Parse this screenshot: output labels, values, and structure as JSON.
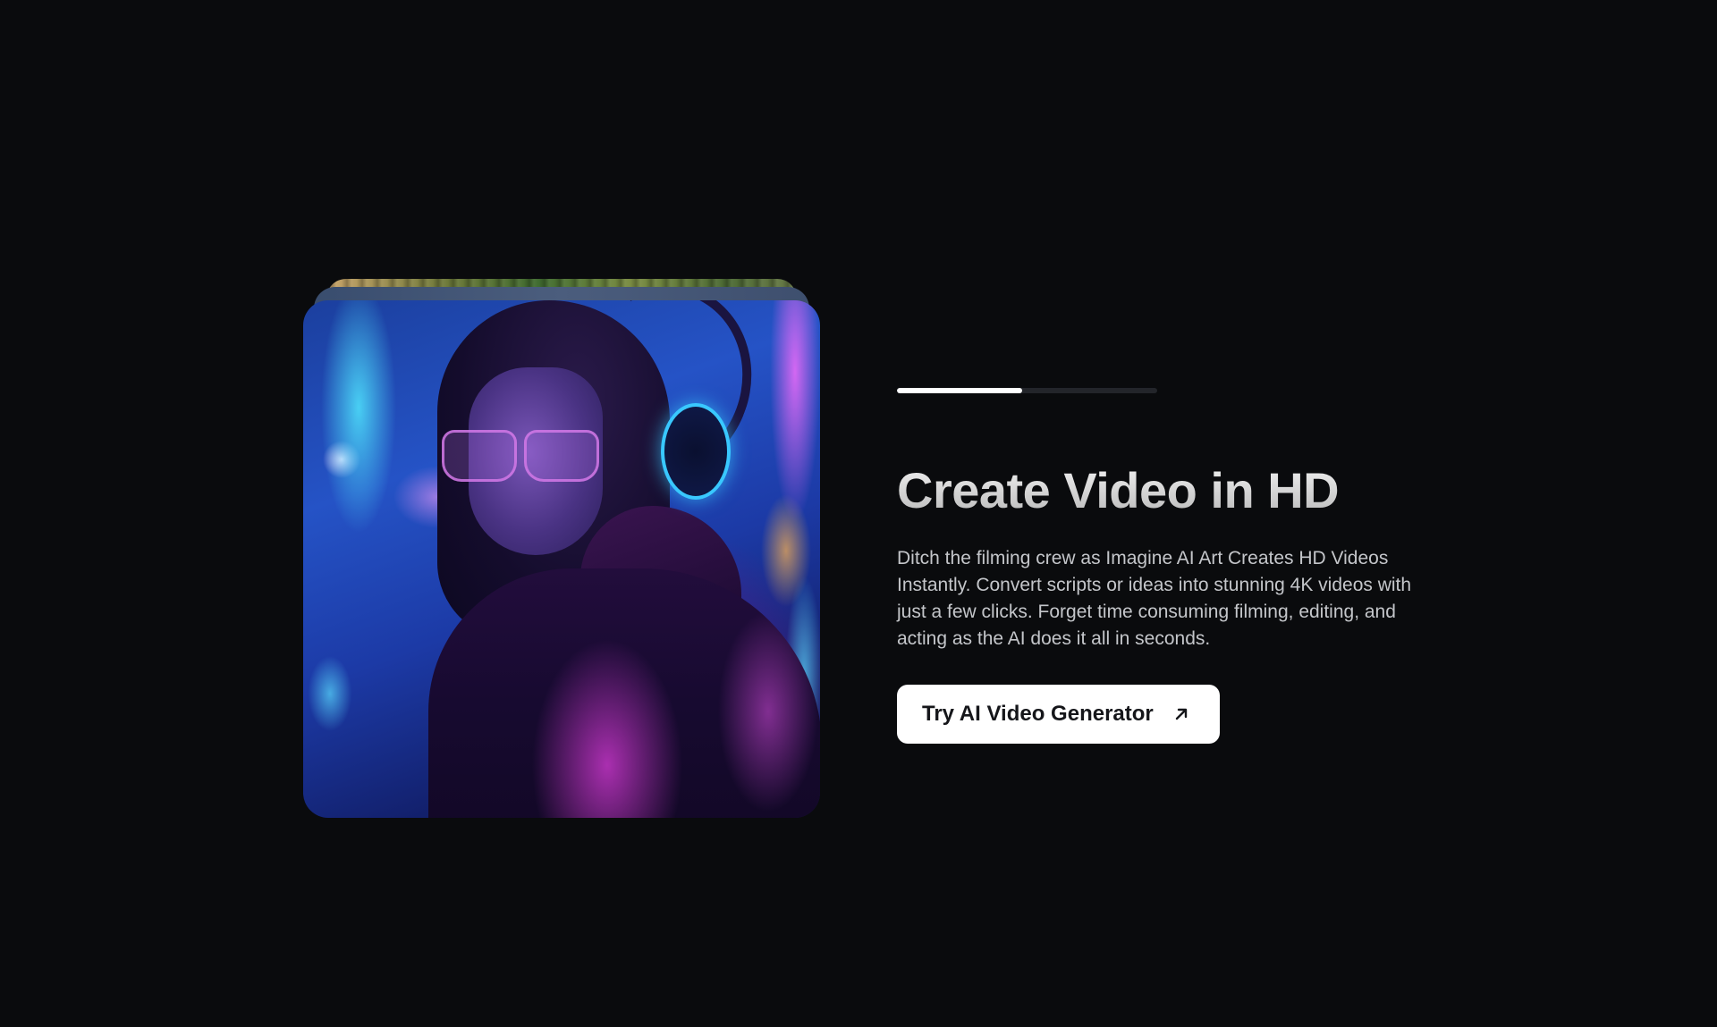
{
  "hero": {
    "progress_fraction": 0.48,
    "title": "Create Video in HD",
    "description": "Ditch the filming crew as Imagine AI Art Creates HD Videos Instantly. Convert scripts or ideas into stunning 4K videos with just a few clicks. Forget time consuming filming, editing, and acting as the AI does it all in seconds.",
    "cta_label": "Try AI Video Generator",
    "cta_icon": "arrow-up-right-icon"
  },
  "colors": {
    "background": "#0a0b0d",
    "accent_button": "#ffffff",
    "progress_track": "#23252a",
    "progress_fill": "#ffffff"
  }
}
